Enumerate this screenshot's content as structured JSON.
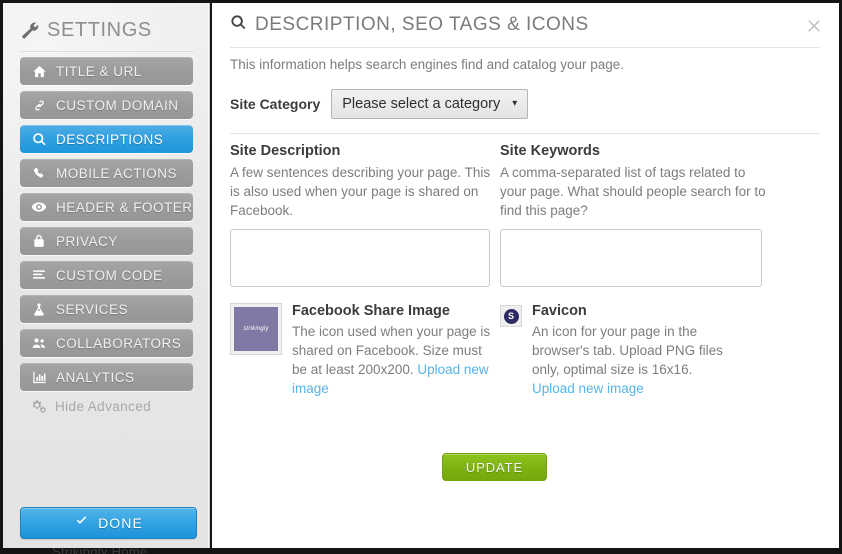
{
  "sidebar": {
    "header": {
      "title": "SETTINGS",
      "icon": "wrench-icon"
    },
    "items": [
      {
        "label": "TITLE & URL",
        "icon": "home-icon",
        "active": false
      },
      {
        "label": "CUSTOM DOMAIN",
        "icon": "link-icon",
        "active": false
      },
      {
        "label": "DESCRIPTIONS",
        "icon": "search-icon",
        "active": true
      },
      {
        "label": "MOBILE ACTIONS",
        "icon": "phone-icon",
        "active": false
      },
      {
        "label": "HEADER & FOOTER",
        "icon": "eye-icon",
        "active": false
      },
      {
        "label": "PRIVACY",
        "icon": "lock-icon",
        "active": false
      },
      {
        "label": "CUSTOM CODE",
        "icon": "code-lines-icon",
        "active": false
      },
      {
        "label": "SERVICES",
        "icon": "flask-icon",
        "active": false
      },
      {
        "label": "COLLABORATORS",
        "icon": "users-icon",
        "active": false
      },
      {
        "label": "ANALYTICS",
        "icon": "bar-chart-icon",
        "active": false
      }
    ],
    "hide_advanced": {
      "label": "Hide Advanced",
      "icon": "gears-icon"
    },
    "done_button": {
      "label": "DONE",
      "icon": "check-icon"
    }
  },
  "panel": {
    "title": "DESCRIPTION, SEO TAGS & ICONS",
    "title_icon": "search-icon",
    "close_icon": "close-icon",
    "intro": "This information helps search engines find and catalog your page.",
    "category": {
      "label": "Site Category",
      "selected": "Please select a category",
      "caret": "▾"
    },
    "description_field": {
      "title": "Site Description",
      "help": "A few sentences describing your page. This is also used when your page is shared on Facebook.",
      "value": "",
      "placeholder": ""
    },
    "keywords_field": {
      "title": "Site Keywords",
      "help": "A comma-separated list of tags related to your page. What should people search for to find this page?",
      "value": "",
      "placeholder": ""
    },
    "facebook_image": {
      "title": "Facebook Share Image",
      "help": "The icon used when your page is shared on Facebook. Size must be at least 200x200. ",
      "upload_link": "Upload new image",
      "thumb_word": "strikingly",
      "thumb_color": "#8278a5"
    },
    "favicon": {
      "title": "Favicon",
      "help": "An icon for your page in the browser's tab. Upload PNG files only, optimal size is 16x16. ",
      "upload_link": "Upload new image",
      "thumb_letter": "S",
      "thumb_color": "#2b2a63"
    },
    "update_button": {
      "label": "UPDATE"
    }
  },
  "background": {
    "cut_off_text": "Strikingly Home"
  },
  "colors": {
    "accent_blue": "#2fa0e0",
    "nav_gray": "#9b9b9b",
    "green": "#7eb312",
    "link_blue": "#56b4e8"
  }
}
